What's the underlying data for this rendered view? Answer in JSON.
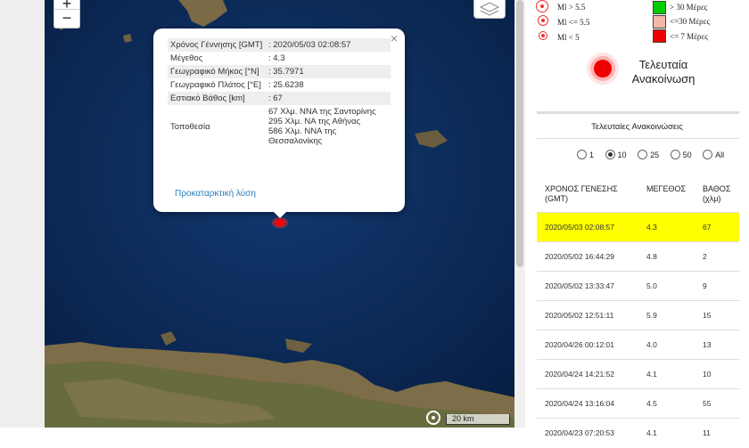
{
  "map": {
    "zoom_in": "+",
    "zoom_out": "−",
    "scale_label": "20 km",
    "popup": {
      "close": "×",
      "rows": [
        {
          "label": "Χρόνος Γέννησης [GMT]",
          "value": ": 2020/05/03 02:08:57"
        },
        {
          "label": "Μέγεθος",
          "value": ": 4.3"
        },
        {
          "label": "Γεωγραφικό Μήκος [°N]",
          "value": ": 35.7971"
        },
        {
          "label": "Γεωγραφικό Πλάτος [°E]",
          "value": ": 25.6238"
        },
        {
          "label": "Εστιακό Βάθος [km]",
          "value": ": 67"
        },
        {
          "label": "Τοποθεσία",
          "value": "67 Χλμ. ΝΝΑ της Σαντορίνης\n295 Χλμ. ΝΑ της Αθήνας\n586 Χλμ. ΝΝΑ της Θεσσαλονίκης"
        }
      ],
      "link": "Προκαταρκτική λύση"
    }
  },
  "legend": {
    "mag": [
      "Ml > 5.5",
      "Ml <= 5.5",
      "Ml < 5"
    ],
    "age": [
      "> 30 Μέρες",
      "<=30 Μέρες",
      "<= 7 Μέρες"
    ],
    "age_colors": [
      "#00cc00",
      "#f4b8a8",
      "#ee0000"
    ]
  },
  "announcement": {
    "line1": "Τελευταία",
    "line2": "Ανακοίνωση"
  },
  "list": {
    "title": "Τελευταίες Ανακοινώσεις",
    "options": [
      "1",
      "10",
      "25",
      "50",
      "All"
    ],
    "selected": "10",
    "headers": {
      "time1": "ΧΡΟΝΟΣ ΓΕΝΕΣΗΣ",
      "time2": "(GMT)",
      "mag": "ΜΕΓΕΘΟΣ",
      "depth1": "ΒΑΘΟΣ",
      "depth2": "(χλμ)"
    },
    "rows": [
      {
        "time": "2020/05/03 02:08:57",
        "mag": "4.3",
        "depth": "67"
      },
      {
        "time": "2020/05/02 16:44:29",
        "mag": "4.8",
        "depth": "2"
      },
      {
        "time": "2020/05/02 13:33:47",
        "mag": "5.0",
        "depth": "9"
      },
      {
        "time": "2020/05/02 12:51:11",
        "mag": "5.9",
        "depth": "15"
      },
      {
        "time": "2020/04/26 00:12:01",
        "mag": "4.0",
        "depth": "13"
      },
      {
        "time": "2020/04/24 14:21:52",
        "mag": "4.1",
        "depth": "10"
      },
      {
        "time": "2020/04/24 13:16:04",
        "mag": "4.5",
        "depth": "55"
      },
      {
        "time": "2020/04/23 07:20:53",
        "mag": "4.1",
        "depth": "11"
      }
    ]
  }
}
